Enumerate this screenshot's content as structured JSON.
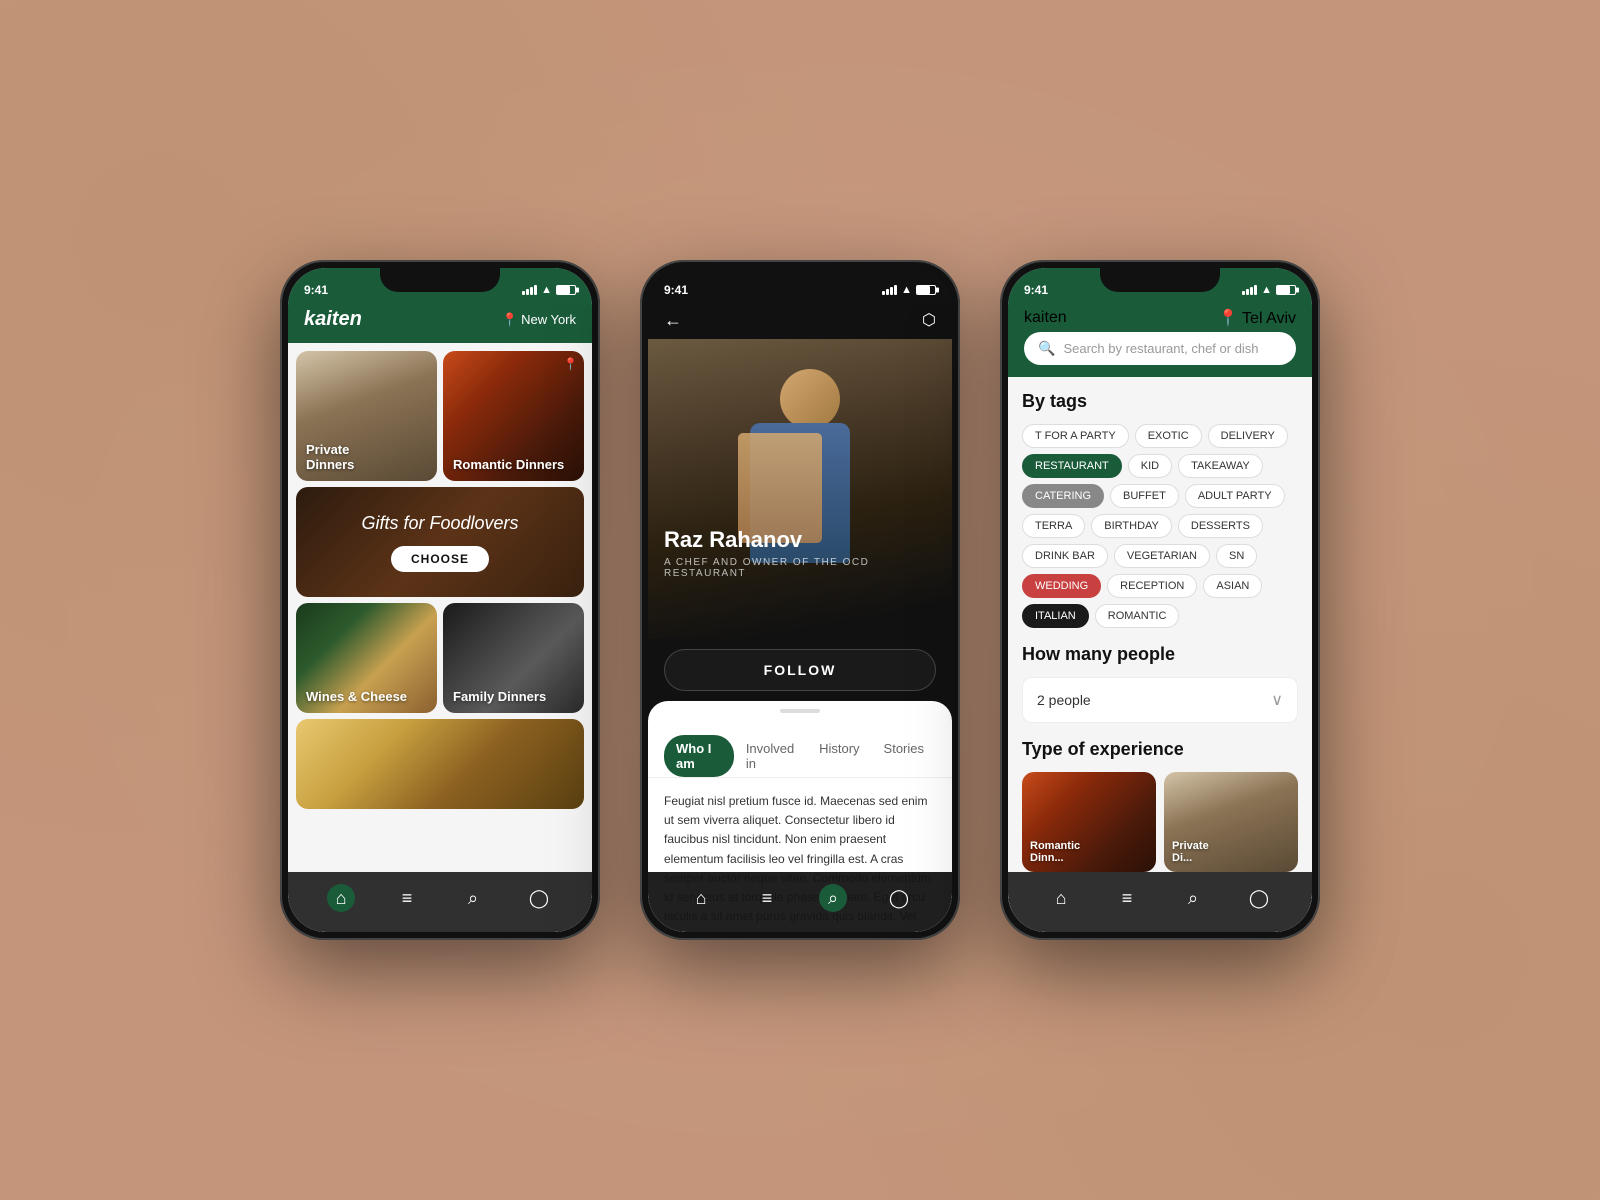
{
  "background": {
    "color": "#c4957a"
  },
  "phone1": {
    "status_time": "9:41",
    "header": {
      "logo": "kaiten",
      "location": "New York"
    },
    "cards": [
      {
        "id": "private-dinners",
        "label": "Private\nDinners"
      },
      {
        "id": "romantic-dinners",
        "label": "Romantic\nDinners"
      },
      {
        "id": "gifts",
        "title": "Gifts for Foodlovers",
        "cta": "CHOOSE"
      },
      {
        "id": "wines-cheese",
        "label": "Wines & Cheese"
      },
      {
        "id": "family-dinners",
        "label": "Family Dinners"
      },
      {
        "id": "pasta",
        "label": ""
      }
    ],
    "nav": {
      "items": [
        "home",
        "menu",
        "search",
        "profile"
      ]
    }
  },
  "phone2": {
    "status_time": "9:41",
    "chef": {
      "name": "Raz Rahanov",
      "subtitle": "A CHEF AND OWNER OF THE OCD RESTAURANT",
      "follow_label": "FOLLOW"
    },
    "tabs": [
      {
        "id": "who-i-am",
        "label": "Who I am",
        "active": true
      },
      {
        "id": "involved-in",
        "label": "Involved in"
      },
      {
        "id": "history",
        "label": "History"
      },
      {
        "id": "stories",
        "label": "Stories"
      }
    ],
    "content": "Feugiat nisl pretium fusce id. Maecenas sed enim ut sem viverra aliquet. Consectetur libero id faucibus nisl tincidunt. Non enim praesent elementum facilisis leo vel fringilla est. A cras semper auctor neque vitae. Commodo elementum id senectus at torquilla phasellus diam. Eget arcu iaculis a sit amet purus gravida quis blandit. Vel orci"
  },
  "phone3": {
    "status_time": "9:41",
    "header": {
      "logo": "kaiten",
      "location": "Tel Aviv"
    },
    "search": {
      "placeholder": "Search by restaurant, chef or dish"
    },
    "tags_section": {
      "title": "By tags",
      "tags": [
        {
          "label": "T FOR A PARTY",
          "style": "outline"
        },
        {
          "label": "EXOTIC",
          "style": "outline"
        },
        {
          "label": "DELIVERY",
          "style": "outline"
        },
        {
          "label": "RESTAURANT",
          "style": "active-green"
        },
        {
          "label": "KID",
          "style": "outline"
        },
        {
          "label": "TAKEAWAY",
          "style": "outline"
        },
        {
          "label": "CATERING",
          "style": "active-catering"
        },
        {
          "label": "BUFFET",
          "style": "outline"
        },
        {
          "label": "ADULT PARTY",
          "style": "outline"
        },
        {
          "label": "TERRA",
          "style": "outline"
        },
        {
          "label": "BIRTHDAY",
          "style": "outline"
        },
        {
          "label": "DESSERTS",
          "style": "outline"
        },
        {
          "label": "DRINK BAR",
          "style": "outline"
        },
        {
          "label": "VEGETARIAN",
          "style": "outline"
        },
        {
          "label": "SN",
          "style": "outline"
        },
        {
          "label": "WEDDING",
          "style": "active-dark-wedding"
        },
        {
          "label": "RECEPTION",
          "style": "outline"
        },
        {
          "label": "ASIAN",
          "style": "outline"
        },
        {
          "label": "ITALIAN",
          "style": "active-dark"
        },
        {
          "label": "ROMANTIC",
          "style": "outline"
        }
      ]
    },
    "people_section": {
      "title": "How many people",
      "value": "2 people"
    },
    "experience_section": {
      "title": "Type of experience",
      "items": [
        {
          "id": "romantic-dinners",
          "label": "Romantic\nDinn..."
        },
        {
          "id": "private-dinners",
          "label": "Private\nDi..."
        }
      ]
    },
    "nav": {
      "items": [
        "home",
        "menu",
        "search",
        "profile"
      ]
    }
  }
}
